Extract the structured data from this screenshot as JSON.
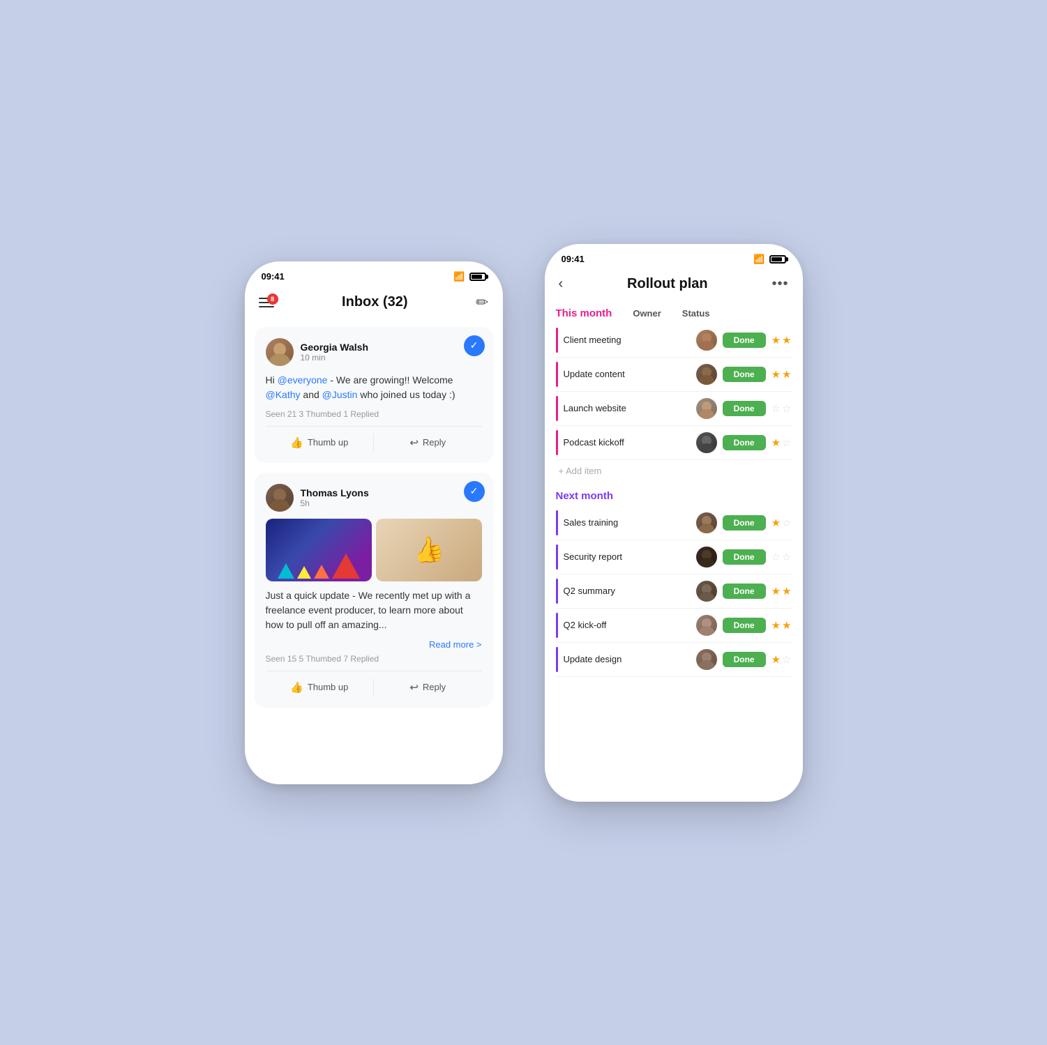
{
  "background_color": "#c5cfe8",
  "phone_left": {
    "status_bar": {
      "time": "09:41",
      "wifi": "📶",
      "battery": "🔋"
    },
    "header": {
      "title": "Inbox (32)",
      "badge": "8",
      "edit_icon": "✏"
    },
    "messages": [
      {
        "id": "msg1",
        "author": "Georgia Walsh",
        "time": "10 min",
        "check": "✓",
        "body_parts": [
          {
            "type": "text",
            "content": "Hi "
          },
          {
            "type": "mention",
            "content": "@everyone"
          },
          {
            "type": "text",
            "content": " - We are growing!! Welcome "
          },
          {
            "type": "mention",
            "content": "@Kathy"
          },
          {
            "type": "text",
            "content": " and "
          },
          {
            "type": "mention",
            "content": "@Justin"
          },
          {
            "type": "text",
            "content": " who joined us today :)"
          }
        ],
        "stats": "Seen 21   3 Thumbed   1 Replied",
        "actions": [
          "Thumb up",
          "Reply"
        ]
      },
      {
        "id": "msg2",
        "author": "Thomas Lyons",
        "time": "5h",
        "check": "✓",
        "body_text": "Just a quick update - We recently met up with a freelance event producer, to learn more about how to pull off an amazing...",
        "has_images": true,
        "read_more": "Read more >",
        "stats": "Seen 15   5 Thumbed   7 Replied",
        "actions": [
          "Thumb up",
          "Reply"
        ]
      }
    ]
  },
  "phone_right": {
    "status_bar": {
      "time": "09:41"
    },
    "header": {
      "title": "Rollout plan",
      "back": "<",
      "more": "..."
    },
    "this_month": {
      "section_label": "This month",
      "col_owner": "Owner",
      "col_status": "Status",
      "items": [
        {
          "name": "Client meeting",
          "status": "Done",
          "stars": 2,
          "max_stars": 2
        },
        {
          "name": "Update content",
          "status": "Done",
          "stars": 2,
          "max_stars": 2
        },
        {
          "name": "Launch website",
          "status": "Done",
          "stars": 0,
          "max_stars": 2
        },
        {
          "name": "Podcast kickoff",
          "status": "Done",
          "stars": 1,
          "max_stars": 2
        }
      ],
      "add_item": "+ Add item"
    },
    "next_month": {
      "section_label": "Next month",
      "items": [
        {
          "name": "Sales training",
          "status": "Done",
          "stars": 1,
          "max_stars": 2
        },
        {
          "name": "Security report",
          "status": "Done",
          "stars": 0,
          "max_stars": 2
        },
        {
          "name": "Q2 summary",
          "status": "Done",
          "stars": 2,
          "max_stars": 2
        },
        {
          "name": "Q2 kick-off",
          "status": "Done",
          "stars": 2,
          "max_stars": 2
        },
        {
          "name": "Update design",
          "status": "Done",
          "stars": 1,
          "max_stars": 2
        }
      ]
    }
  }
}
